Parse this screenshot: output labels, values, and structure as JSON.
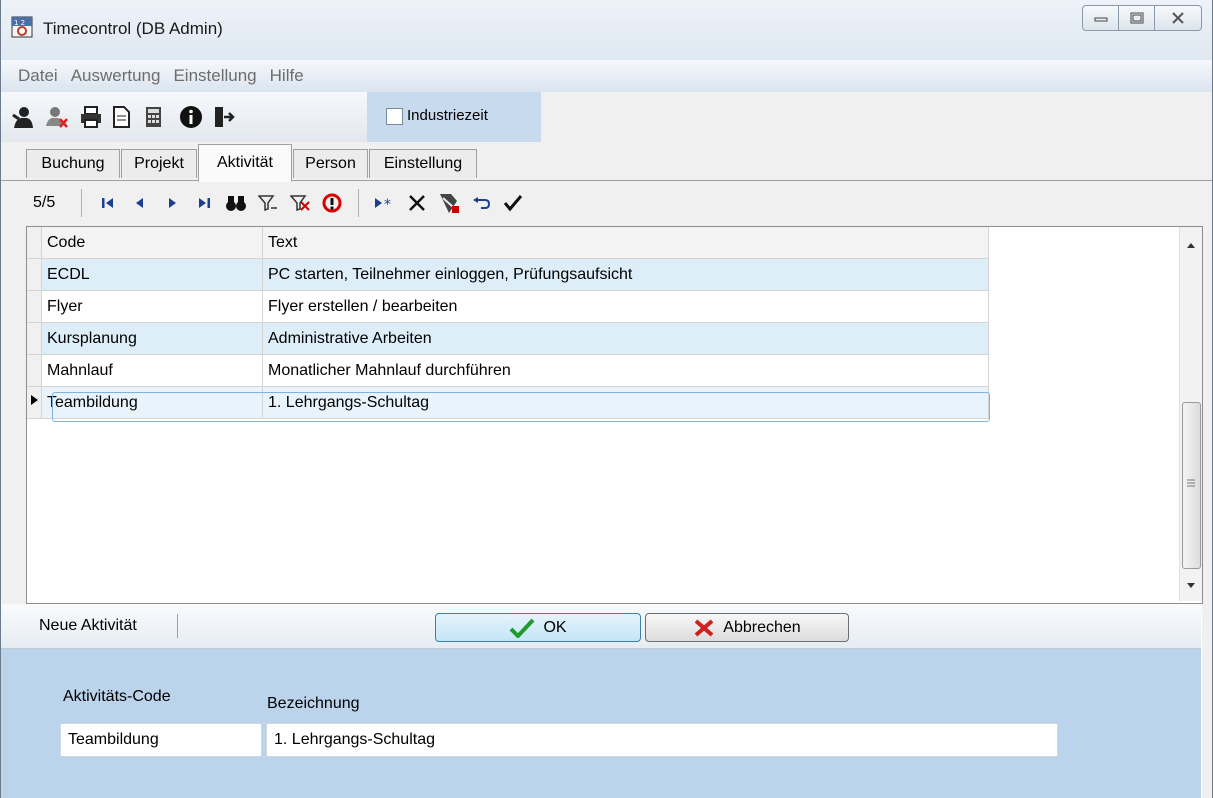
{
  "window": {
    "title": "Timecontrol (DB Admin)"
  },
  "menu": [
    "Datei",
    "Auswertung",
    "Einstellung",
    "Hilfe"
  ],
  "toolbar": {
    "icons": [
      "user-icon",
      "user-delete-icon",
      "printer-icon",
      "document-icon",
      "calculator-icon",
      "info-icon",
      "exit-icon"
    ],
    "industriezeit_label": "Industriezeit",
    "industriezeit_checked": false
  },
  "tabs": [
    "Buchung",
    "Projekt",
    "Aktivität",
    "Person",
    "Einstellung"
  ],
  "active_tab": "Aktivität",
  "navigator": {
    "position": "5/5"
  },
  "grid": {
    "columns": [
      "Code",
      "Text"
    ],
    "rows": [
      {
        "code": "ECDL",
        "text": "PC starten, Teilnehmer einloggen, Prüfungsaufsicht"
      },
      {
        "code": "Flyer",
        "text": "Flyer erstellen / bearbeiten"
      },
      {
        "code": "Kursplanung",
        "text": "Administrative Arbeiten"
      },
      {
        "code": "Mahnlauf",
        "text": "Monatlicher Mahnlauf durchführen"
      },
      {
        "code": "Teambildung",
        "text": "1. Lehrgangs-Schultag"
      }
    ],
    "selected_row": 4
  },
  "editor": {
    "mode_label": "Neue Aktivität",
    "ok_label": "OK",
    "cancel_label": "Abbrechen",
    "code_label": "Aktivitäts-Code",
    "name_label": "Bezeichnung",
    "code_value": "Teambildung",
    "name_value": "1. Lehrgangs-Schultag"
  }
}
